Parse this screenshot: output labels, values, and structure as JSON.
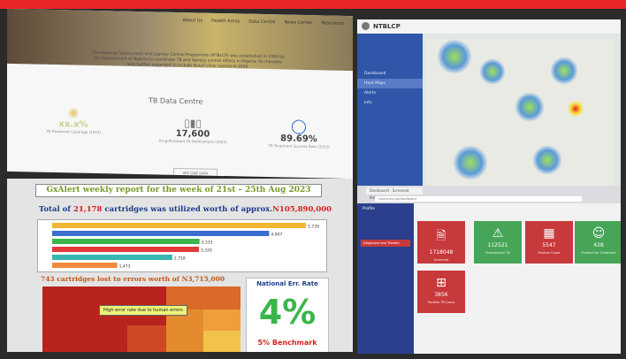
{
  "screens": {
    "tl": {
      "nav": [
        "About Us",
        "Health Areas",
        "Data Centre",
        "News Center",
        "Resources"
      ],
      "intro": "The National Tuberculosis and Leprosy Control Programme (NTBLCP) was established in 1989 by the Government of Nigeria to coordinate TB and leprosy control efforts in Nigeria. Its mandate was further expanded to include Buruli Ulcer control in 2006.",
      "title": "TB Data Centre",
      "stats": [
        {
          "value": "xx.x%",
          "label": "TB Treatment Coverage (2023)"
        },
        {
          "value": "17,600",
          "label": "Drug-Resistant TB Notifications (2023)"
        },
        {
          "value": "89.69%",
          "label": "TB Treatment Success Rate (2023)"
        }
      ],
      "button": "SEE ONE DATA"
    },
    "tr": {
      "brand": "NTBLCP",
      "menu": [
        "Dashboard",
        "Heat Maps",
        "Alerts",
        "Info"
      ]
    },
    "bl": {
      "header": "GxAlert weekly report for the week of 21st – 25th Aug 2023",
      "total_prefix": "Total of ",
      "total_count": "21,178",
      "total_mid": " cartridges was utilized worth of approx.",
      "total_amount": "N105,890,000",
      "errors_count": "743",
      "errors_mid": " cartridges lost to errors worth of ",
      "errors_amount": "N3,715,000",
      "rate_title": "National Err. Rate",
      "rate_value": "4%",
      "benchmark": "5% Benchmark",
      "annotation": "High error rate due to human errors"
    },
    "br": {
      "tab": "Dashboard - Screened Patients",
      "address": "ntblcp.org.ng/dashboard",
      "profile": "Profile",
      "side_item": "Diagnosed and Treated",
      "tiles": [
        {
          "value": "1718048",
          "label": "Screened",
          "color": "#c8393b",
          "icon": "file-icon"
        },
        {
          "value": "112521",
          "label": "Presumptive TB",
          "color": "#47a557",
          "icon": "warning-icon"
        },
        {
          "value": "5547",
          "label": "Positive Cases",
          "color": "#c8393b",
          "icon": "building-icon"
        },
        {
          "value": "428",
          "label": "Enrolled for Treatment",
          "color": "#47a557",
          "icon": "user-icon"
        },
        {
          "value": "3856",
          "label": "Positive TB Cases",
          "color": "#c8393b",
          "icon": "plus-icon"
        }
      ]
    }
  },
  "chart_data": {
    "type": "bar",
    "orientation": "horizontal",
    "categories": [
      "",
      "",
      "",
      "",
      "",
      ""
    ],
    "values": [
      5739,
      4907,
      3333,
      3320,
      2718,
      1473
    ],
    "colors": [
      "#f2b632",
      "#3a6fd0",
      "#3bb54a",
      "#e23a3a",
      "#35b6b0",
      "#f08a3a"
    ]
  }
}
